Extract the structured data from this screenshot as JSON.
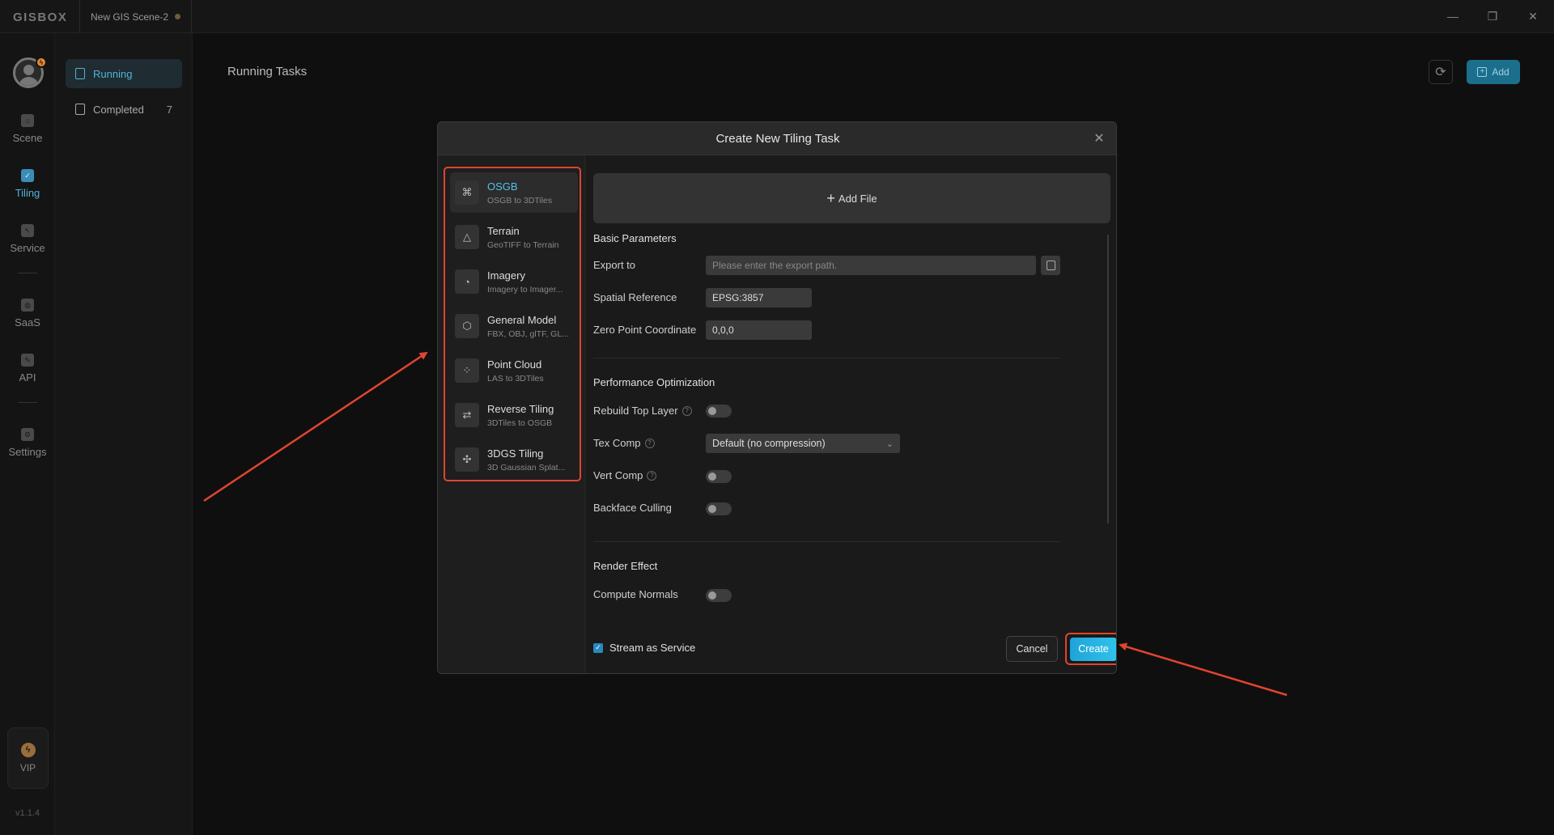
{
  "app": {
    "logo": "GISBOX",
    "tab_title": "New GIS Scene-2"
  },
  "window_controls": {
    "minimize": "—",
    "restore": "❐",
    "close": "✕"
  },
  "rail": {
    "items": [
      {
        "label": "Scene",
        "icon": "home-icon"
      },
      {
        "label": "Tiling",
        "icon": "tiling-icon",
        "active": true
      },
      {
        "label": "Service",
        "icon": "service-icon"
      },
      {
        "label": "SaaS",
        "icon": "saas-icon"
      },
      {
        "label": "API",
        "icon": "api-icon"
      },
      {
        "label": "Settings",
        "icon": "gear-icon"
      }
    ],
    "vip_label": "VIP",
    "version": "v1.1.4"
  },
  "subnav": {
    "running_label": "Running",
    "completed_label": "Completed",
    "completed_count": "7"
  },
  "main": {
    "title": "Running Tasks",
    "add_label": "Add"
  },
  "modal": {
    "title": "Create New Tiling Task",
    "types": [
      {
        "title": "OSGB",
        "subtitle": "OSGB to 3DTiles",
        "icon": "⌘",
        "active": true
      },
      {
        "title": "Terrain",
        "subtitle": "GeoTIFF to Terrain",
        "icon": "△"
      },
      {
        "title": "Imagery",
        "subtitle": "Imagery to Imager...",
        "icon": "◔"
      },
      {
        "title": "General Model",
        "subtitle": "FBX, OBJ, glTF, GL...",
        "icon": "⬡"
      },
      {
        "title": "Point Cloud",
        "subtitle": "LAS to 3DTiles",
        "icon": "⁘"
      },
      {
        "title": "Reverse Tiling",
        "subtitle": "3DTiles to OSGB",
        "icon": "⇄"
      },
      {
        "title": "3DGS Tiling",
        "subtitle": "3D Gaussian Splat...",
        "icon": "✣"
      }
    ],
    "add_file_label": "Add File",
    "basic": {
      "title": "Basic Parameters",
      "export_label": "Export to",
      "export_placeholder": "Please enter the export path.",
      "spatial_label": "Spatial Reference",
      "spatial_value": "EPSG:3857",
      "zero_label": "Zero Point Coordinate",
      "zero_value": "0,0,0"
    },
    "performance": {
      "title": "Performance Optimization",
      "rebuild_label": "Rebuild Top Layer",
      "rebuild_on": false,
      "texcomp_label": "Tex Comp",
      "texcomp_value": "Default (no compression)",
      "vertcomp_label": "Vert Comp",
      "vertcomp_on": false,
      "backface_label": "Backface Culling",
      "backface_on": false
    },
    "render": {
      "title": "Render Effect",
      "normals_label": "Compute Normals",
      "normals_on": false
    },
    "stream_label": "Stream as Service",
    "stream_checked": true,
    "cancel_label": "Cancel",
    "create_label": "Create"
  },
  "colors": {
    "accent": "#4fb3d9",
    "annotation": "#e0442f",
    "create": "#29b6e6"
  }
}
